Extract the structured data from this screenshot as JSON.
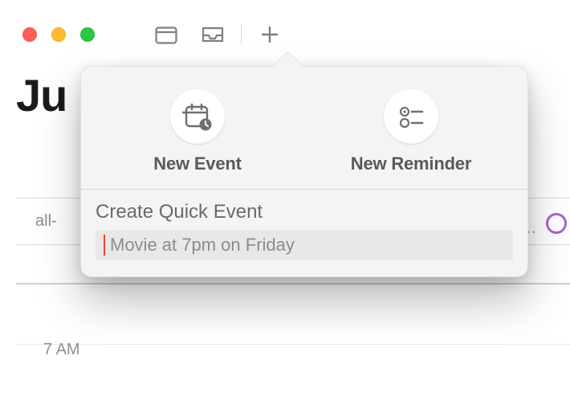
{
  "titlebar": {
    "traffic": {
      "close": "close",
      "minimize": "minimize",
      "zoom": "zoom"
    },
    "toolbar": {
      "calendars_icon": "calendars-icon",
      "inbox_icon": "inbox-icon",
      "add_icon": "plus-icon"
    }
  },
  "month": {
    "title_visible": "Ju"
  },
  "grid": {
    "all_day_label": "all-",
    "hour_label_7am": "7 AM",
    "overflow1": "…",
    "overflow2": "."
  },
  "popover": {
    "new_event_label": "New Event",
    "new_reminder_label": "New Reminder",
    "quick_title": "Create Quick Event",
    "quick_placeholder": "Movie at 7pm on Friday",
    "quick_value": ""
  },
  "colors": {
    "accent_purple": "#a763d4",
    "cursor_red": "#ff3b30"
  }
}
